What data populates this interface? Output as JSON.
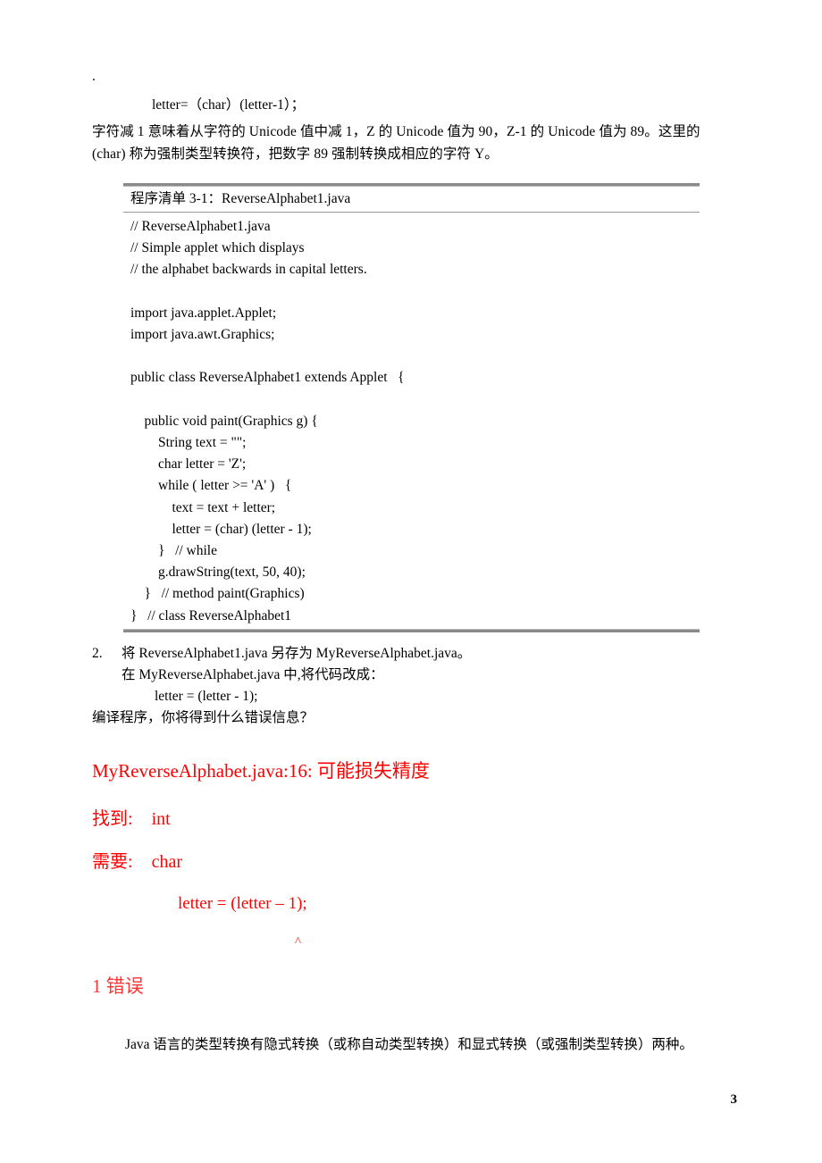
{
  "page": {
    "number": "3",
    "top_mark": "."
  },
  "intro": {
    "code_line": "letter=（char）(letter-1）；",
    "paragraph_lines": [
      "字符减 1 意味着从字符的 Unicode 值中减 1，Z 的 Unicode 值为 90，Z-1 的 Unicode 值为 89。这里的",
      "(char) 称为强制类型转换符，把数字 89 强制转换成相应的字符 Y。"
    ]
  },
  "listing": {
    "title": "程序清单 3-1：ReverseAlphabet1.java",
    "lines": [
      "// ReverseAlphabet1.java",
      "// Simple applet which displays",
      "// the alphabet backwards in capital letters.",
      "",
      "import java.applet.Applet;",
      "import java.awt.Graphics;",
      "",
      "public class ReverseAlphabet1 extends Applet   {",
      "",
      "    public void paint(Graphics g) {",
      "        String text = \"\";",
      "        char letter = 'Z';",
      "        while ( letter >= 'A' )   {",
      "            text = text + letter;",
      "            letter = (char) (letter - 1);",
      "        }   // while",
      "        g.drawString(text, 50, 40);",
      "    }   // method paint(Graphics)",
      "}   // class ReverseAlphabet1"
    ]
  },
  "exercise": {
    "number": "2.",
    "line1": "将 ReverseAlphabet1.java 另存为 MyReverseAlphabet.java。",
    "line2": "在 MyReverseAlphabet.java 中,将代码改成：",
    "code": "letter = (letter - 1);",
    "line3": "编译程序，你将得到什么错误信息？"
  },
  "error_output": {
    "color": "#FF0000",
    "count_color": "#FF3333",
    "header": "MyReverseAlphabet.java:16: 可能损失精度",
    "found_label": "找到:",
    "found_value": "int",
    "need_label": "需要:",
    "need_value": "char",
    "code_line": "letter = (letter – 1);",
    "caret": "^",
    "count_line": "1  错误"
  },
  "conclusion": {
    "text": "Java 语言的类型转换有隐式转换（或称自动类型转换）和显式转换（或强制类型转换）两种。"
  }
}
